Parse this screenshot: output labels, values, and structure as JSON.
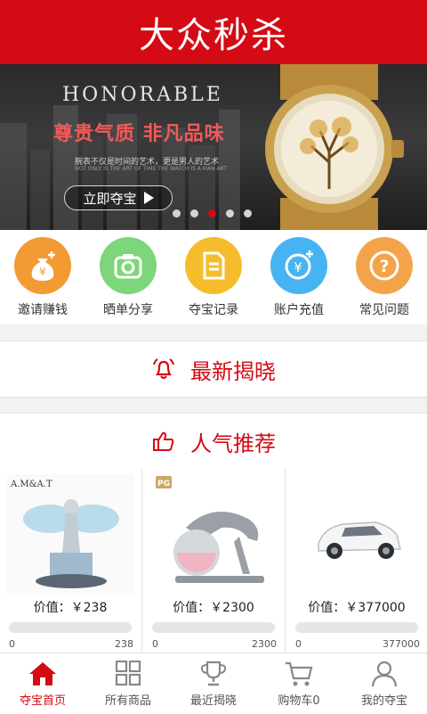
{
  "header": {
    "title": "大众秒杀"
  },
  "banner": {
    "brand": "HONORABLE",
    "slogan": "尊贵气质  非凡品味",
    "sub_line1": "腕表不仅是时间的艺术，更是男人的艺术",
    "sub_line2": "NOT ONLY IS THE ART OF TIME THE WATCH IS A MAN ART",
    "cta": "立即夺宝",
    "slides": 5,
    "active_slide": 2
  },
  "quick_actions": [
    {
      "label": "邀请赚钱",
      "color": "#f39a33",
      "icon": "money-bag-icon"
    },
    {
      "label": "晒单分享",
      "color": "#7dd67a",
      "icon": "camera-icon"
    },
    {
      "label": "夺宝记录",
      "color": "#f5bd2c",
      "icon": "document-icon"
    },
    {
      "label": "账户充值",
      "color": "#46b4f2",
      "icon": "yuan-coin-icon"
    },
    {
      "label": "常见问题",
      "color": "#f5a34a",
      "icon": "question-icon"
    }
  ],
  "sections": {
    "latest": "最新揭晓",
    "popular": "人气推荐"
  },
  "products": [
    {
      "price_label": "价值：￥238",
      "min": "0",
      "max": "238",
      "progress": 0,
      "image_text": "A.M&A.T",
      "image": "fairy-ornament"
    },
    {
      "price_label": "价值：￥2300",
      "min": "0",
      "max": "2300",
      "progress": 0,
      "image_text": "PG",
      "image": "leopard-ornament"
    },
    {
      "price_label": "价值：￥377000",
      "min": "0",
      "max": "377000",
      "progress": 0,
      "image_text": "",
      "image": "white-car"
    }
  ],
  "tabs": [
    {
      "label": "夺宝首页",
      "icon": "home-icon",
      "active": true
    },
    {
      "label": "所有商品",
      "icon": "grid-icon",
      "active": false
    },
    {
      "label": "最近揭晓",
      "icon": "trophy-icon",
      "active": false
    },
    {
      "label": "购物车0",
      "icon": "cart-icon",
      "active": false
    },
    {
      "label": "我的夺宝",
      "icon": "user-icon",
      "active": false
    }
  ],
  "colors": {
    "brand_red": "#d40a14"
  }
}
